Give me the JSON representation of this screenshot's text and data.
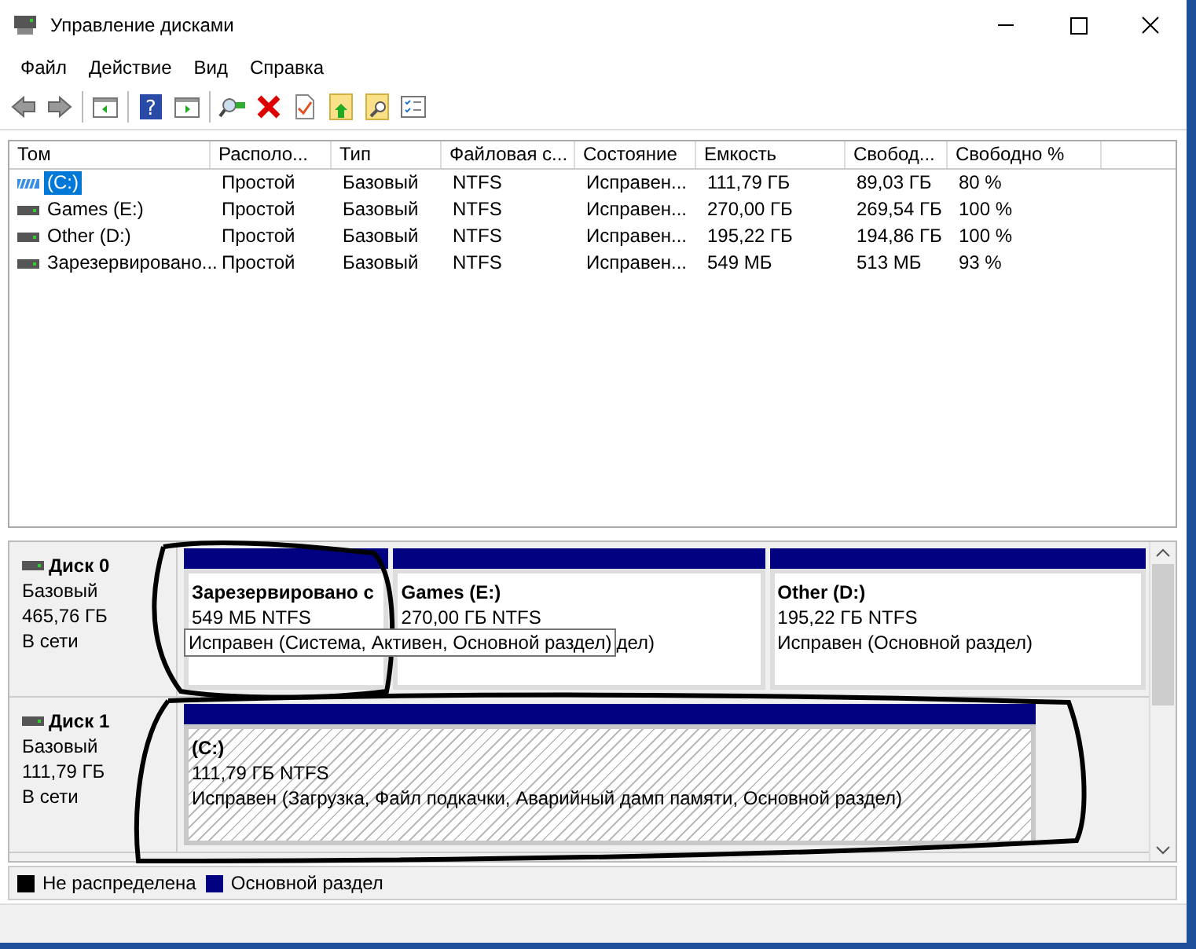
{
  "window": {
    "title": "Управление дисками"
  },
  "menu": [
    "Файл",
    "Действие",
    "Вид",
    "Справка"
  ],
  "toolbar": [
    {
      "kind": "back"
    },
    {
      "kind": "forward"
    },
    {
      "kind": "sep"
    },
    {
      "kind": "panel"
    },
    {
      "kind": "sep"
    },
    {
      "kind": "help",
      "glyph": "?"
    },
    {
      "kind": "panel2"
    },
    {
      "kind": "sep"
    },
    {
      "kind": "connect"
    },
    {
      "kind": "delete"
    },
    {
      "kind": "check"
    },
    {
      "kind": "folder-up"
    },
    {
      "kind": "folder-search"
    },
    {
      "kind": "list"
    }
  ],
  "table": {
    "columns": [
      "Том",
      "Располо...",
      "Тип",
      "Файловая с...",
      "Состояние",
      "Емкость",
      "Свобод...",
      "Свободно %"
    ],
    "rows": [
      {
        "selected": true,
        "cells": [
          "(C:)",
          "Простой",
          "Базовый",
          "NTFS",
          "Исправен...",
          "111,79 ГБ",
          "89,03 ГБ",
          "80 %"
        ]
      },
      {
        "selected": false,
        "cells": [
          "Games (E:)",
          "Простой",
          "Базовый",
          "NTFS",
          "Исправен...",
          "270,00 ГБ",
          "269,54 ГБ",
          "100 %"
        ]
      },
      {
        "selected": false,
        "cells": [
          "Other (D:)",
          "Простой",
          "Базовый",
          "NTFS",
          "Исправен...",
          "195,22 ГБ",
          "194,86 ГБ",
          "100 %"
        ]
      },
      {
        "selected": false,
        "cells": [
          "Зарезервировано...",
          "Простой",
          "Базовый",
          "NTFS",
          "Исправен...",
          "549 МБ",
          "513 МБ",
          "93 %"
        ]
      }
    ]
  },
  "disks": [
    {
      "name": "Диск 0",
      "type": "Базовый",
      "size": "465,76 ГБ",
      "status": "В сети",
      "partitions": [
        {
          "label": "Зарезервировано с",
          "size": "549 МБ NTFS",
          "selected": false
        },
        {
          "label": "Games  (E:)",
          "size": "270,00 ГБ NTFS",
          "status": "дел)",
          "selected": false
        },
        {
          "label": "Other  (D:)",
          "size": "195,22 ГБ NTFS",
          "status": "Исправен (Основной раздел)",
          "selected": false
        }
      ]
    },
    {
      "name": "Диск 1",
      "type": "Базовый",
      "size": "111,79 ГБ",
      "status": "В сети",
      "partitions": [
        {
          "label": "(C:)",
          "size": "111,79 ГБ NTFS",
          "status": "Исправен (Загрузка, Файл подкачки, Аварийный дамп памяти, Основной раздел)",
          "selected": true
        }
      ]
    }
  ],
  "tooltip": "Исправен (Система, Активен, Основной раздел)",
  "legend": [
    {
      "label": "Не распределена",
      "color": "#000000"
    },
    {
      "label": "Основной раздел",
      "color": "#000080"
    }
  ]
}
